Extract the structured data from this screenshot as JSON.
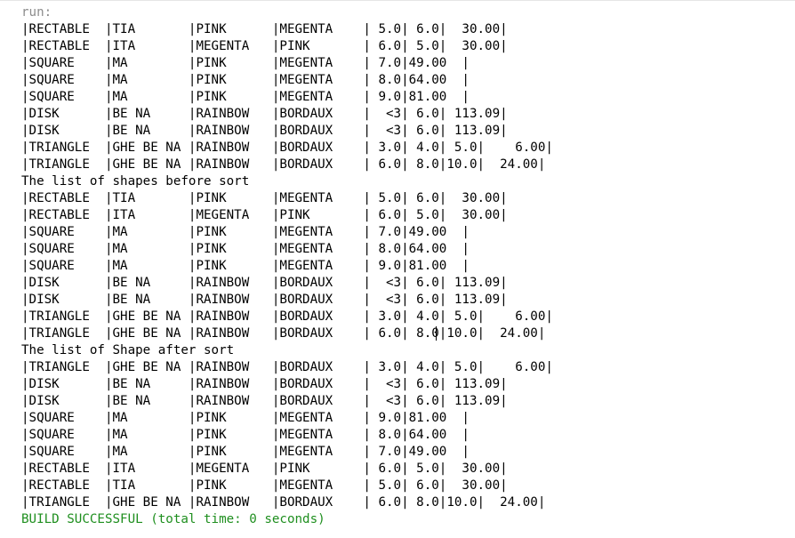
{
  "console": {
    "run_label": "run:",
    "lines": [
      "|RECTABLE  |TIA       |PINK      |MEGENTA    | 5.0| 6.0|  30.00|",
      "|RECTABLE  |ITA       |MEGENTA   |PINK       | 6.0| 5.0|  30.00|",
      "|SQUARE    |MA        |PINK      |MEGENTA    | 7.0|49.00  |",
      "|SQUARE    |MA        |PINK      |MEGENTA    | 8.0|64.00  |",
      "|SQUARE    |MA        |PINK      |MEGENTA    | 9.0|81.00  |",
      "|DISK      |BE NA     |RAINBOW   |BORDAUX    |  <3| 6.0| 113.09|",
      "|DISK      |BE NA     |RAINBOW   |BORDAUX    |  <3| 6.0| 113.09|",
      "|TRIANGLE  |GHE BE NA |RAINBOW   |BORDAUX    | 3.0| 4.0| 5.0|    6.00|",
      "|TRIANGLE  |GHE BE NA |RAINBOW   |BORDAUX    | 6.0| 8.0|10.0|  24.00|",
      "The list of shapes before sort",
      "|RECTABLE  |TIA       |PINK      |MEGENTA    | 5.0| 6.0|  30.00|",
      "|RECTABLE  |ITA       |MEGENTA   |PINK       | 6.0| 5.0|  30.00|",
      "|SQUARE    |MA        |PINK      |MEGENTA    | 7.0|49.00  |",
      "|SQUARE    |MA        |PINK      |MEGENTA    | 8.0|64.00  |",
      "|SQUARE    |MA        |PINK      |MEGENTA    | 9.0|81.00  |",
      "|DISK      |BE NA     |RAINBOW   |BORDAUX    |  <3| 6.0| 113.09|",
      "|DISK      |BE NA     |RAINBOW   |BORDAUX    |  <3| 6.0| 113.09|",
      "|TRIANGLE  |GHE BE NA |RAINBOW   |BORDAUX    | 3.0| 4.0| 5.0|    6.00|",
      "|TRIANGLE  |GHE BE NA |RAINBOW   |BORDAUX    | 6.0| 8.0|10.0|  24.00|",
      "The list of Shape after sort",
      "|TRIANGLE  |GHE BE NA |RAINBOW   |BORDAUX    | 3.0| 4.0| 5.0|    6.00|",
      "|DISK      |BE NA     |RAINBOW   |BORDAUX    |  <3| 6.0| 113.09|",
      "|DISK      |BE NA     |RAINBOW   |BORDAUX    |  <3| 6.0| 113.09|",
      "|SQUARE    |MA        |PINK      |MEGENTA    | 9.0|81.00  |",
      "|SQUARE    |MA        |PINK      |MEGENTA    | 8.0|64.00  |",
      "|SQUARE    |MA        |PINK      |MEGENTA    | 7.0|49.00  |",
      "|RECTABLE  |ITA       |MEGENTA   |PINK       | 6.0| 5.0|  30.00|",
      "|RECTABLE  |TIA       |PINK      |MEGENTA    | 5.0| 6.0|  30.00|",
      "|TRIANGLE  |GHE BE NA |RAINBOW   |BORDAUX    | 6.0| 8.0|10.0|  24.00|"
    ],
    "build_status": "BUILD SUCCESSFUL (total time: 0 seconds)",
    "colors": {
      "run_label": "#8c8c8c",
      "build_success": "#1f8f1f",
      "text": "#000000"
    }
  }
}
